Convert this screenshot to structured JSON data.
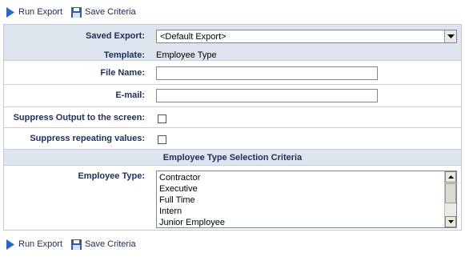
{
  "toolbar": {
    "run_export": "Run Export",
    "save_criteria": "Save Criteria"
  },
  "form": {
    "saved_export_label": "Saved Export:",
    "saved_export_value": "<Default Export>",
    "template_label": "Template:",
    "template_value": "Employee Type",
    "file_name_label": "File Name:",
    "email_label": "E-mail:",
    "suppress_output_label": "Suppress Output to the screen:",
    "suppress_repeating_label": "Suppress repeating values:",
    "section_title": "Employee Type Selection Criteria",
    "employee_type_label": "Employee Type:",
    "employee_types": [
      "Contractor",
      "Executive",
      "Full Time",
      "Intern",
      "Junior Employee"
    ]
  },
  "colors": {
    "label": "#1e2f5a",
    "shaded_row": "#dfe5ef",
    "run_icon": "#2a66c9",
    "save_icon": "#2a5db0"
  }
}
